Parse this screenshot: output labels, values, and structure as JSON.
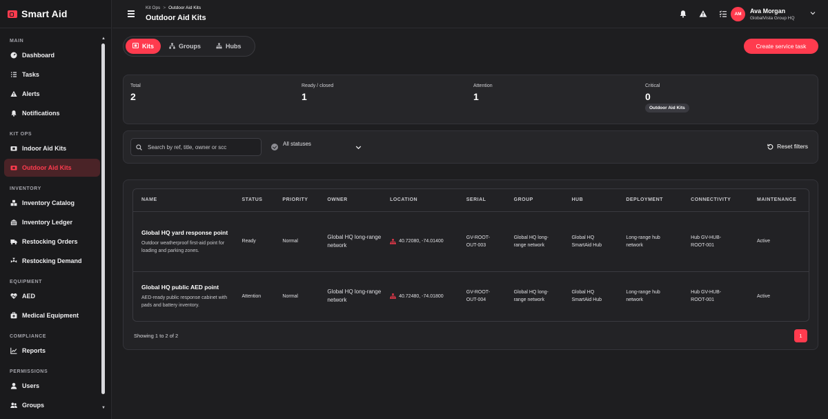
{
  "brand": {
    "name": "Smart Aid"
  },
  "sidebar": {
    "sections": [
      {
        "title": "MAIN",
        "items": [
          {
            "label": "Dashboard",
            "icon": "gauge-icon"
          },
          {
            "label": "Tasks",
            "icon": "tasks-icon"
          },
          {
            "label": "Alerts",
            "icon": "warning-icon"
          },
          {
            "label": "Notifications",
            "icon": "bell-icon"
          }
        ]
      },
      {
        "title": "KIT OPS",
        "items": [
          {
            "label": "Indoor Aid Kits",
            "icon": "kit-icon"
          },
          {
            "label": "Outdoor Aid Kits",
            "icon": "kit-icon",
            "active": true
          }
        ]
      },
      {
        "title": "INVENTORY",
        "items": [
          {
            "label": "Inventory Catalog",
            "icon": "boxes-icon"
          },
          {
            "label": "Inventory Ledger",
            "icon": "ledger-icon"
          },
          {
            "label": "Restocking Orders",
            "icon": "truck-icon"
          },
          {
            "label": "Restocking Demand",
            "icon": "demand-icon"
          }
        ]
      },
      {
        "title": "EQUIPMENT",
        "items": [
          {
            "label": "AED",
            "icon": "heart-pulse-icon"
          },
          {
            "label": "Medical Equipment",
            "icon": "medical-kit-icon"
          }
        ]
      },
      {
        "title": "COMPLIANCE",
        "items": [
          {
            "label": "Reports",
            "icon": "chart-line-icon"
          }
        ]
      },
      {
        "title": "PERMISSIONS",
        "items": [
          {
            "label": "Users",
            "icon": "user-icon"
          },
          {
            "label": "Groups",
            "icon": "users-icon"
          }
        ]
      }
    ]
  },
  "header": {
    "breadcrumb": {
      "parent": "Kit Ops",
      "separator": ">",
      "current": "Outdoor Aid Kits"
    },
    "title": "Outdoor Aid Kits",
    "user": {
      "initials": "AM",
      "name": "Ava Morgan",
      "org": "GlobalVista Group HQ"
    }
  },
  "tabs": [
    {
      "label": "Kits",
      "active": true
    },
    {
      "label": "Groups"
    },
    {
      "label": "Hubs"
    }
  ],
  "actions": {
    "create": "Create service task"
  },
  "stats": {
    "total": {
      "label": "Total",
      "value": "2"
    },
    "ready": {
      "label": "Ready / closed",
      "value": "1"
    },
    "attention": {
      "label": "Attention",
      "value": "1"
    },
    "critical": {
      "label": "Critical",
      "value": "0",
      "chip": "Outdoor Aid Kits"
    }
  },
  "filters": {
    "search_placeholder": "Search by ref, title, owner or scc",
    "status": "All statuses",
    "reset": "Reset filters"
  },
  "table": {
    "columns": [
      "NAME",
      "STATUS",
      "PRIORITY",
      "OWNER",
      "LOCATION",
      "SERIAL",
      "GROUP",
      "HUB",
      "DEPLOYMENT",
      "CONNECTIVITY",
      "MAINTENANCE"
    ],
    "rows": [
      {
        "name": "Global HQ yard response point",
        "description": "Outdoor weatherproof first-aid point for loading and parking zones.",
        "status": "Ready",
        "priority": "Normal",
        "owner": "Global HQ long-range network",
        "location": "40.72080, -74.01400",
        "serial": "GV-ROOT-OUT-003",
        "group": "Global HQ long-range network",
        "hub": "Global HQ SmartAid Hub",
        "deployment": "Long-range hub network",
        "connectivity": "Hub GV-HUB-ROOT-001",
        "maintenance": "Active"
      },
      {
        "name": "Global HQ public AED point",
        "description": "AED-ready public response cabinet with pads and battery inventory.",
        "status": "Attention",
        "priority": "Normal",
        "owner": "Global HQ long-range network",
        "location": "40.72480, -74.01800",
        "serial": "GV-ROOT-OUT-004",
        "group": "Global HQ long-range network",
        "hub": "Global HQ SmartAid Hub",
        "deployment": "Long-range hub network",
        "connectivity": "Hub GV-HUB-ROOT-001",
        "maintenance": "Active"
      }
    ]
  },
  "pagination": {
    "summary": "Showing 1 to 2 of 2",
    "current_page": "1"
  },
  "colors": {
    "accent": "#ff3b4e",
    "background": "#1e1e20",
    "panel": "#262629",
    "sidebar": "#1a1a1c"
  }
}
